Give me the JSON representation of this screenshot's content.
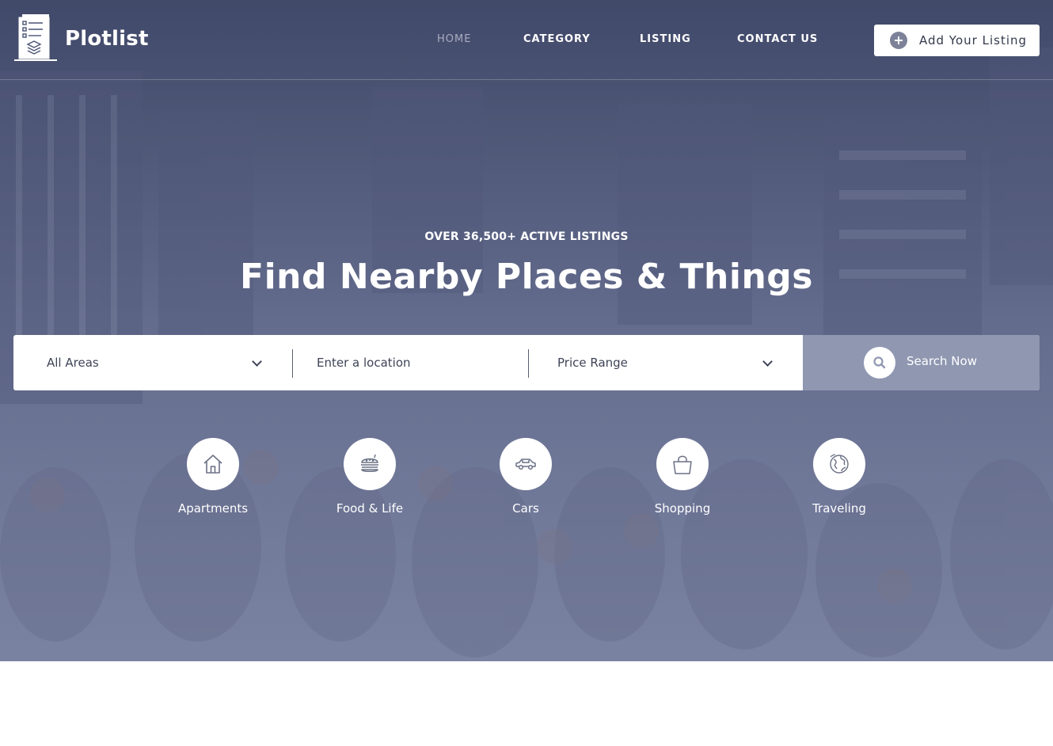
{
  "brand": {
    "name": "Plotlist"
  },
  "nav": {
    "items": [
      {
        "label": "HOME",
        "active": true
      },
      {
        "label": "CATEGORY",
        "active": false
      },
      {
        "label": "LISTING",
        "active": false
      },
      {
        "label": "CONTACT US",
        "active": false
      }
    ],
    "cta_label": "Add Your Listing"
  },
  "hero": {
    "kicker": "OVER 36,500+ ACTIVE LISTINGS",
    "headline": "Find Nearby Places & Things"
  },
  "search": {
    "area_value": "All Areas",
    "location_placeholder": "Enter a location",
    "price_value": "Price Range",
    "button_label": "Search Now"
  },
  "categories": [
    {
      "label": "Apartments",
      "icon": "house-icon"
    },
    {
      "label": "Food & Life",
      "icon": "burger-icon"
    },
    {
      "label": "Cars",
      "icon": "car-icon"
    },
    {
      "label": "Shopping",
      "icon": "shopping-bag-icon"
    },
    {
      "label": "Traveling",
      "icon": "globe-icon"
    }
  ],
  "colors": {
    "hero_tint": "#5a6283",
    "search_button": "#8f97b1",
    "nav_active": "#a9adc0",
    "icon_stroke": "#6b7185"
  }
}
